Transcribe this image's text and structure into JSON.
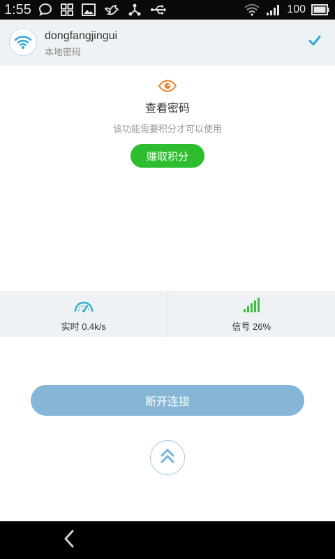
{
  "status_bar": {
    "time": "1:55",
    "battery": "100",
    "left_icons": [
      "chat-bubble-icon",
      "grid-icon",
      "image-icon",
      "bird-icon",
      "share-icon",
      "usb-icon"
    ],
    "right_icons": [
      "wifi-icon",
      "signal-icon",
      "battery-icon"
    ]
  },
  "header": {
    "ssid": "dongfangjingui",
    "subtitle": "本地密码",
    "icon": "wifi-icon",
    "status_icon": "check-icon"
  },
  "password": {
    "icon": "eye-icon",
    "title": "查看密码",
    "description": "该功能需要积分才可以使用",
    "button_label": "赚取积分"
  },
  "stats": {
    "speed_label": "实时 0.4k/s",
    "speed_icon": "speedometer-icon",
    "signal_label": "信号 26%",
    "signal_icon": "signal-bars-icon"
  },
  "actions": {
    "disconnect_label": "断开连接",
    "up_icon": "double-chevron-up-icon"
  },
  "nav": {
    "back_icon": "back-chevron-icon"
  },
  "colors": {
    "accent": "#2ebd2e",
    "disconnect": "#85b6d6",
    "header_bg": "#eef2f5",
    "icon_blue": "#2fa9de",
    "eye_orange": "#e8832a"
  }
}
